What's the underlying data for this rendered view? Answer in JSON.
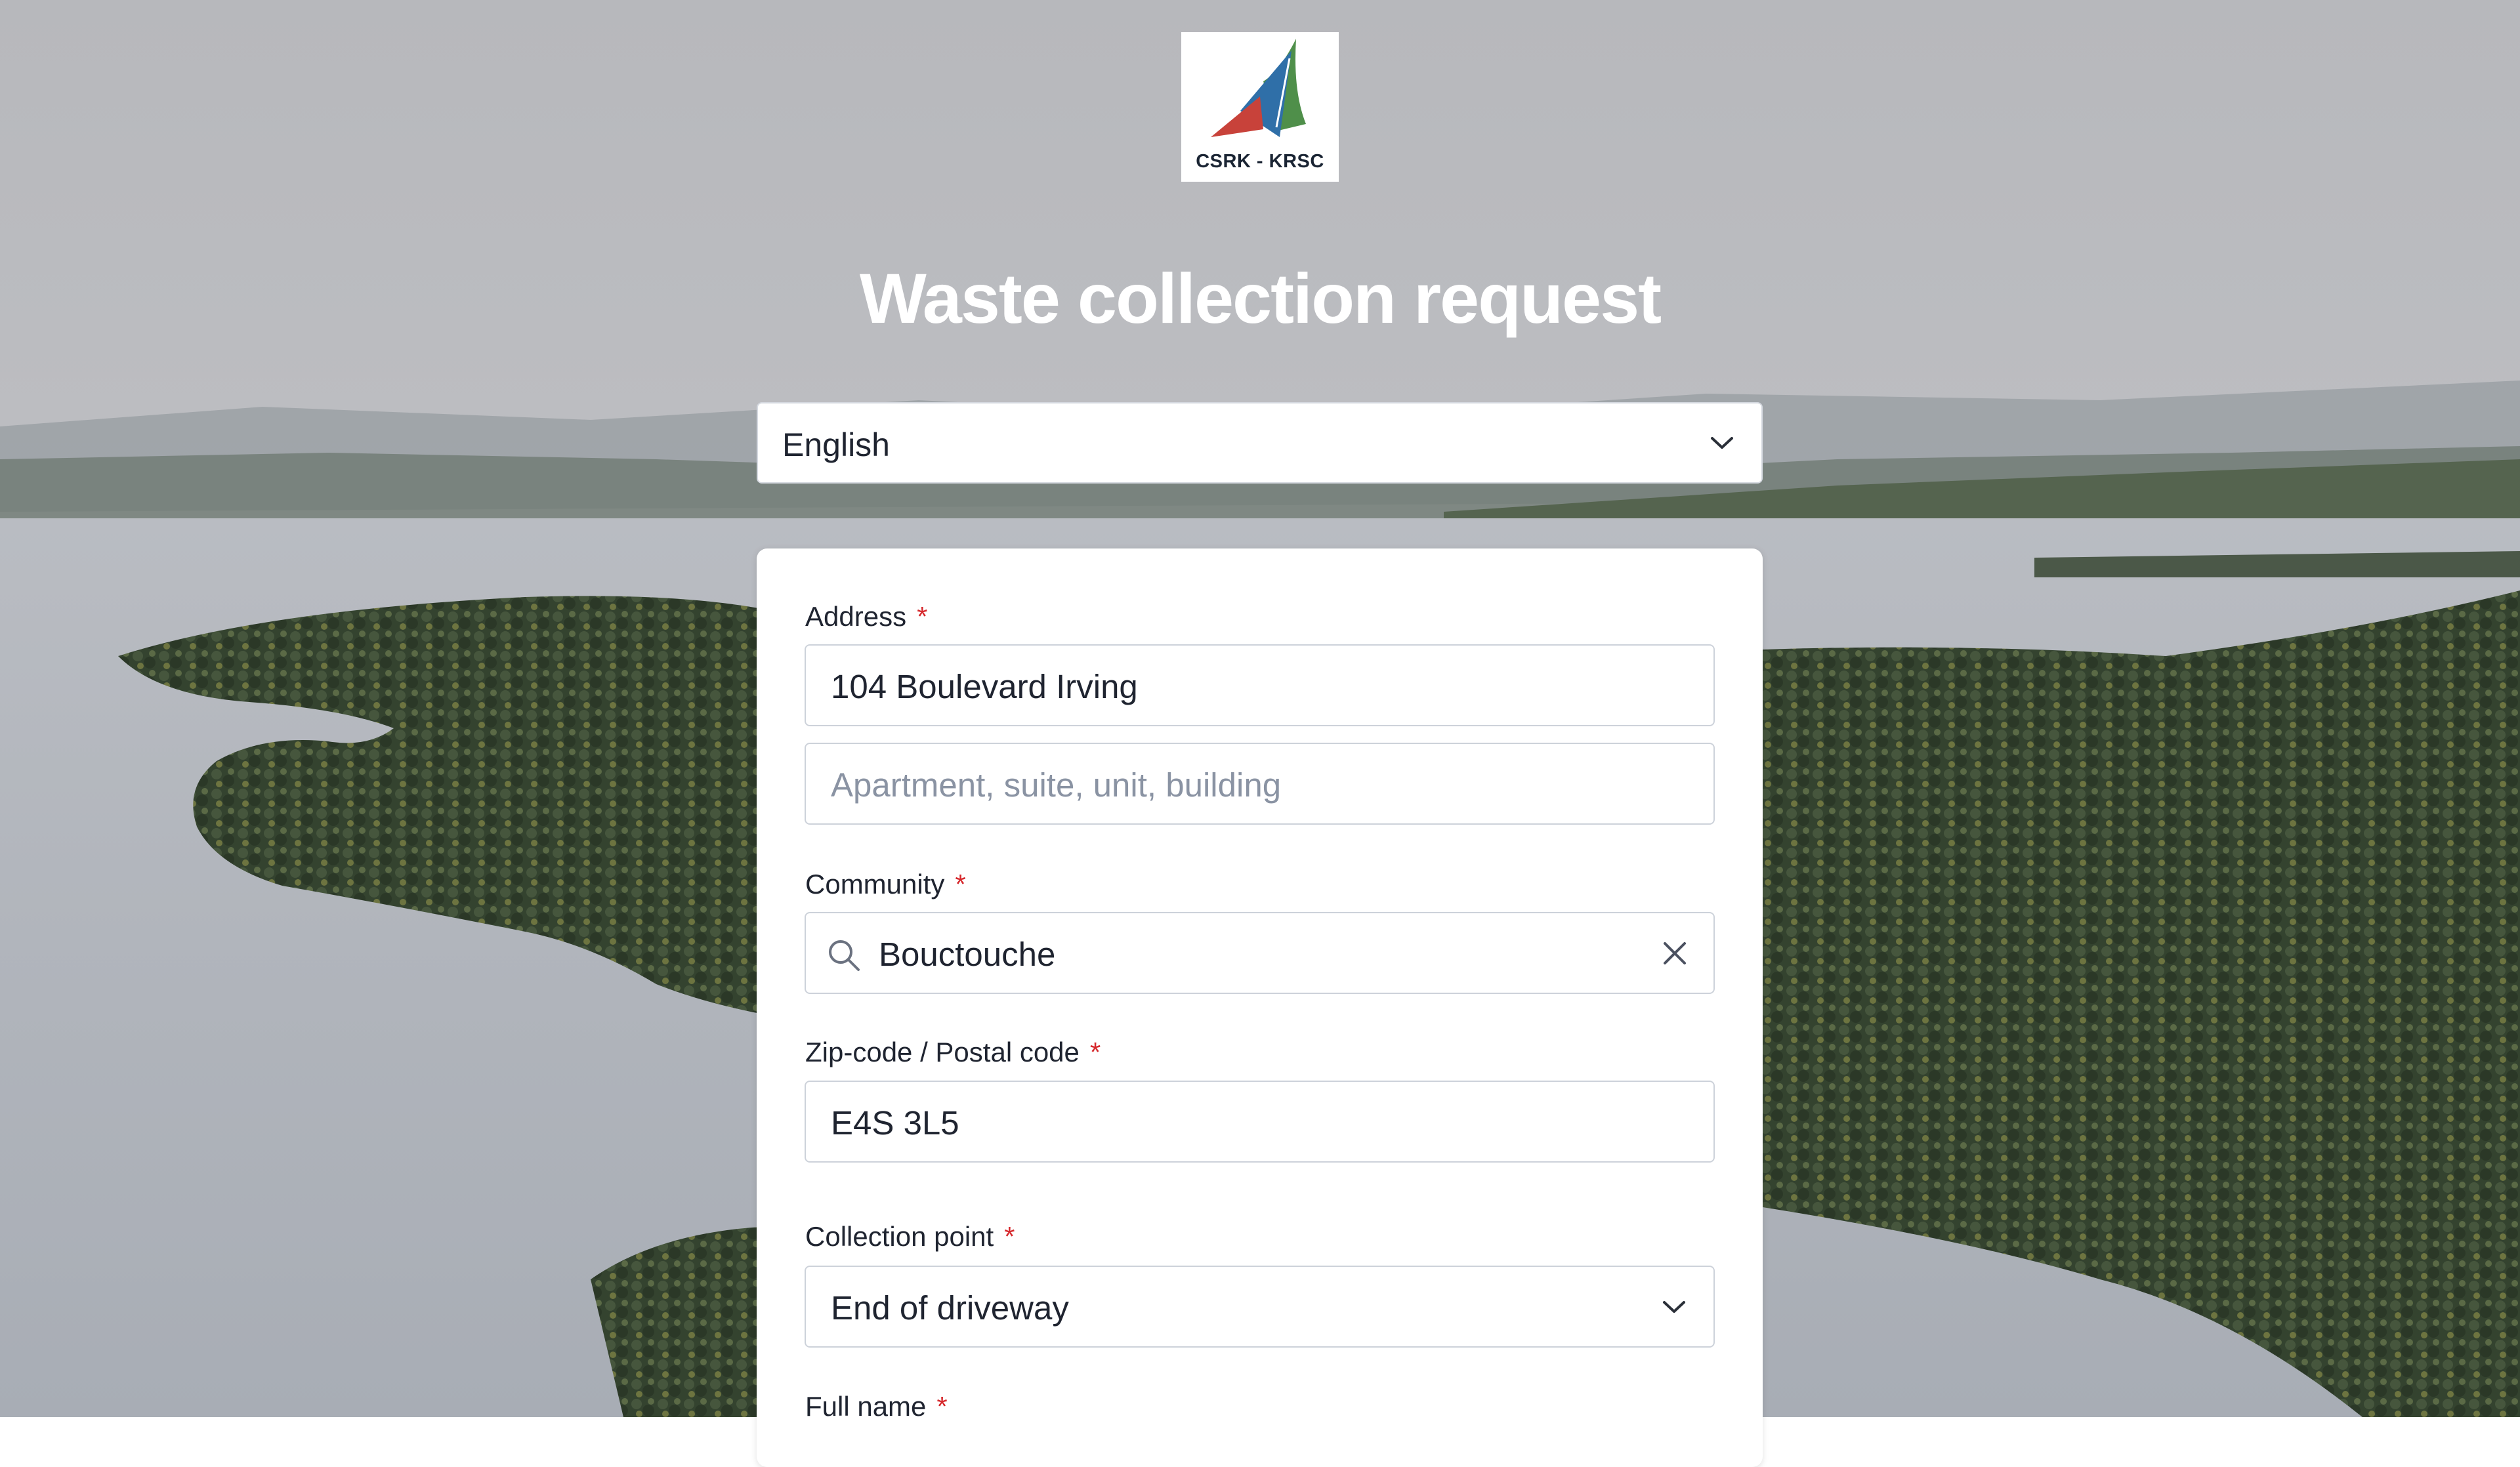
{
  "logo": {
    "text": "CSRK - KRSC"
  },
  "page_title": "Waste collection request",
  "language_select": {
    "value": "English"
  },
  "form": {
    "address": {
      "label": "Address",
      "required_mark": "*",
      "line1_value": "104 Boulevard Irving",
      "line2_placeholder": "Apartment, suite, unit, building"
    },
    "community": {
      "label": "Community",
      "required_mark": "*",
      "value": "Bouctouche"
    },
    "postal_code": {
      "label": "Zip-code / Postal code",
      "required_mark": "*",
      "value": "E4S 3L5"
    },
    "collection_point": {
      "label": "Collection point",
      "required_mark": "*",
      "value": "End of driveway"
    },
    "full_name": {
      "label": "Full name",
      "required_mark": "*"
    }
  },
  "icons": {
    "language_chevron": "chevron-down-icon",
    "community_search": "search-icon",
    "community_clear": "close-icon",
    "collection_chevron": "chevron-down-icon"
  },
  "colors": {
    "required_asterisk": "#d6282c",
    "logo_green": "#4f8f4a",
    "logo_blue": "#2f6fa8",
    "logo_red": "#c8423a"
  }
}
